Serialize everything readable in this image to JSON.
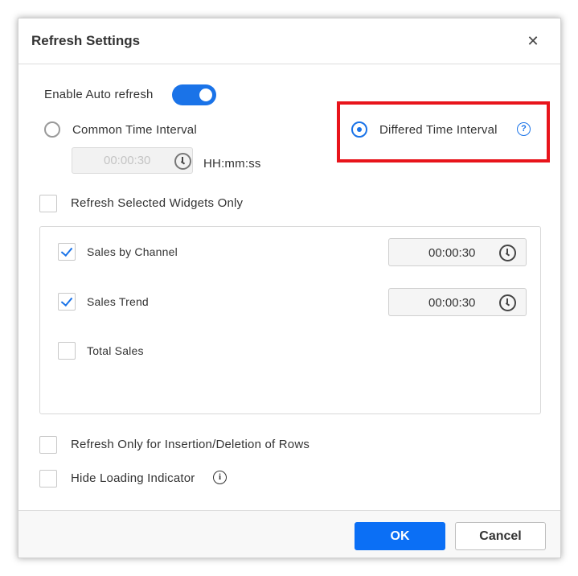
{
  "dialog": {
    "title": "Refresh Settings",
    "close_glyph": "✕"
  },
  "auto_refresh": {
    "label": "Enable Auto refresh",
    "enabled": true
  },
  "interval_mode": {
    "common_label": "Common Time Interval",
    "differed_label": "Differed Time Interval",
    "selected": "differed",
    "help_glyph": "?"
  },
  "common_interval": {
    "value": "00:00:30",
    "format_label": "HH:mm:ss"
  },
  "selected_widgets": {
    "label": "Refresh Selected Widgets Only",
    "checked": false
  },
  "widgets": [
    {
      "name": "Sales by Channel",
      "checked": true,
      "interval": "00:00:30"
    },
    {
      "name": "Sales Trend",
      "checked": true,
      "interval": "00:00:30"
    },
    {
      "name": "Total Sales",
      "checked": false
    }
  ],
  "options": {
    "insert_delete_label": "Refresh Only for Insertion/Deletion of Rows",
    "hide_loading_label": "Hide Loading Indicator",
    "info_glyph": "i"
  },
  "footer": {
    "ok_label": "OK",
    "cancel_label": "Cancel"
  },
  "colors": {
    "accent": "#1a73e8",
    "highlight": "#e8141b",
    "primary_button": "#0b6ff5"
  },
  "icons": [
    "close-icon",
    "help-icon",
    "clock-icon",
    "check-icon",
    "info-icon"
  ]
}
